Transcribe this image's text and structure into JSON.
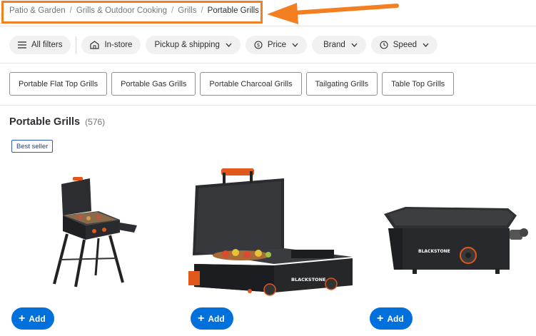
{
  "breadcrumb": {
    "items": [
      "Patio & Garden",
      "Grills & Outdoor Cooking",
      "Grills"
    ],
    "current": "Portable Grills",
    "separator": "/"
  },
  "filters": {
    "all_filters": "All filters",
    "in_store": "In-store",
    "pickup_shipping": "Pickup & shipping",
    "price": "Price",
    "brand": "Brand",
    "speed": "Speed"
  },
  "categories": [
    "Portable Flat Top Grills",
    "Portable Gas Grills",
    "Portable Charcoal Grills",
    "Tailgating Grills",
    "Table Top Grills"
  ],
  "results": {
    "title": "Portable Grills",
    "count": "(576)"
  },
  "badge": "Best seller",
  "products": [
    {
      "add_label": "Add",
      "brand_mark": ""
    },
    {
      "add_label": "Add",
      "brand_mark": "BLACKSTONE"
    },
    {
      "add_label": "Add",
      "brand_mark": "BLACKSTONE"
    }
  ],
  "colors": {
    "highlight": "#f47f20",
    "add_button": "#0071dc",
    "pill_bg": "#f1f1f2"
  }
}
